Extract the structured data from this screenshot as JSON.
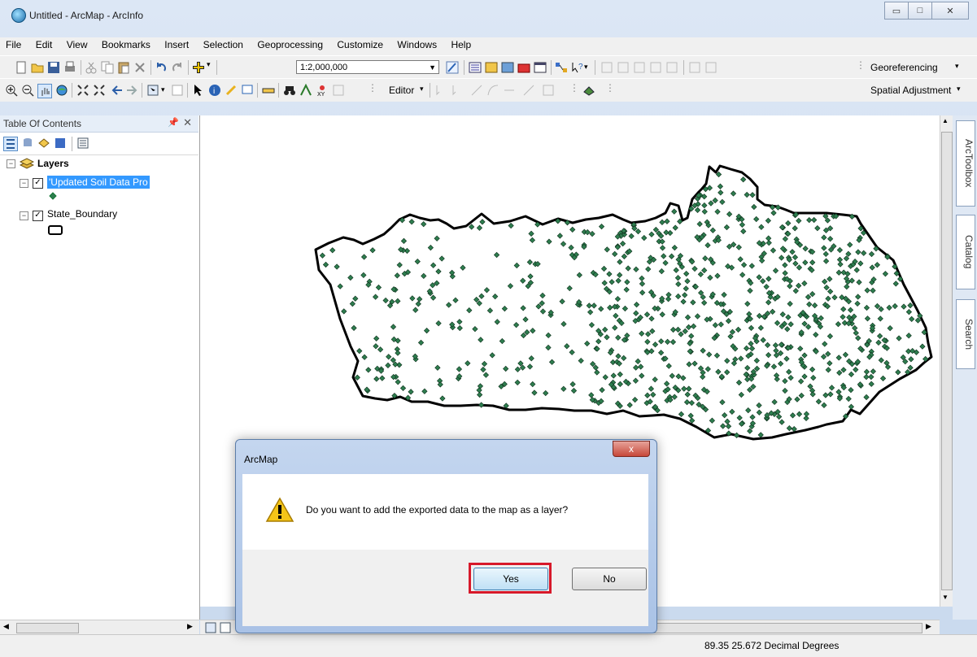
{
  "window": {
    "title": "Untitled - ArcMap - ArcInfo"
  },
  "menu": [
    "File",
    "Edit",
    "View",
    "Bookmarks",
    "Insert",
    "Selection",
    "Geoprocessing",
    "Customize",
    "Windows",
    "Help"
  ],
  "toolbar": {
    "scale": "1:2,000,000",
    "georeferencing": "Georeferencing",
    "editor": "Editor",
    "spatial_adjustment": "Spatial Adjustment"
  },
  "toc": {
    "title": "Table Of Contents",
    "root": "Layers",
    "layers": [
      {
        "name": "'Updated Soil Data Pro",
        "checked": true,
        "selected": true
      },
      {
        "name": "State_Boundary",
        "checked": true
      }
    ]
  },
  "side_tabs": [
    "ArcToolbox",
    "Catalog",
    "Search"
  ],
  "status": {
    "coords": "89.35  25.672 Decimal Degrees"
  },
  "dialog": {
    "title": "ArcMap",
    "close": "x",
    "message": "Do you want to add the exported data to the map as a layer?",
    "yes": "Yes",
    "no": "No"
  },
  "colors": {
    "points": "#2e7d4f",
    "boundary": "#000000",
    "highlight": "#d7192a"
  }
}
